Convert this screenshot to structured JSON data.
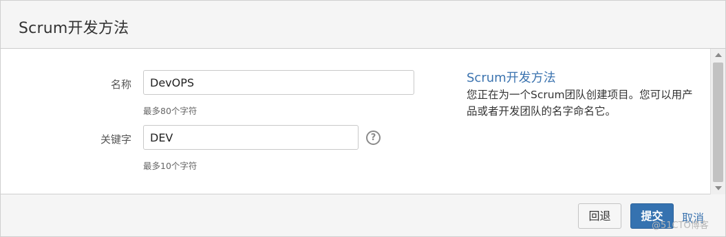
{
  "dialog": {
    "title": "Scrum开发方法"
  },
  "form": {
    "name": {
      "label": "名称",
      "value": "DevOPS",
      "hint": "最多80个字符"
    },
    "key": {
      "label": "关键字",
      "value": "DEV",
      "hint": "最多10个字符",
      "help_icon": "question-circle-icon"
    }
  },
  "info": {
    "title": "Scrum开发方法",
    "description": "您正在为一个Scrum团队创建项目。您可以用产品或者开发团队的名字命名它。"
  },
  "footer": {
    "back_label": "回退",
    "submit_label": "提交",
    "cancel_label": "取消"
  },
  "watermark": "@51CTO博客",
  "colors": {
    "accent": "#3572b0",
    "link": "#3b73af"
  }
}
